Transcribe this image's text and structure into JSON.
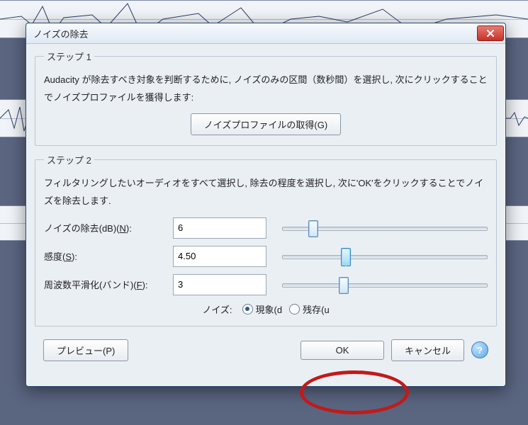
{
  "dialog": {
    "title": "ノイズの除去",
    "step1": {
      "legend": "ステップ 1",
      "description": "Audacity が除去すべき対象を判断するために, ノイズのみの区間（数秒間）を選択し, 次にクリックすることでノイズプロファイルを獲得します:",
      "get_profile_btn": "ノイズプロファイルの取得(G)"
    },
    "step2": {
      "legend": "ステップ 2",
      "description": "フィルタリングしたいオーディオをすべて選択し, 除去の程度を選択し, 次に'OK'をクリックすることでノイズを除去します.",
      "noise_reduction": {
        "label": "ノイズの除去(dB)(N):",
        "value": "6",
        "slider_pct": 15
      },
      "sensitivity": {
        "label": "感度(S):",
        "value": "4.50",
        "slider_pct": 31
      },
      "smoothing": {
        "label": "周波数平滑化(バンド)(F):",
        "value": "3",
        "slider_pct": 30
      },
      "noise_label": "ノイズ:",
      "radio_remove": "現象(d",
      "radio_residue": "残存(u",
      "radio_selected": "remove"
    },
    "footer": {
      "preview": "プレビュー(P)",
      "ok": "OK",
      "cancel": "キャンセル",
      "help": "?"
    }
  }
}
